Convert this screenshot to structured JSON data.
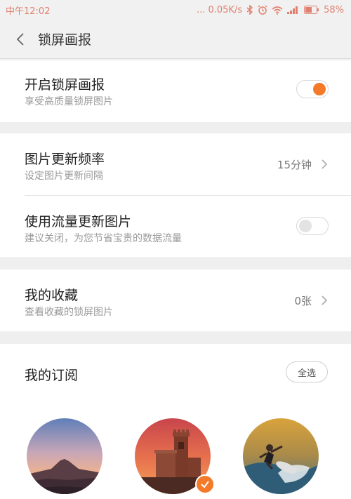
{
  "status_bar": {
    "time": "中午12:02",
    "network_speed": "... 0.05K/s",
    "battery": "58%",
    "icons": [
      "bluetooth-icon",
      "alarm-icon",
      "wifi-icon",
      "signal-icon",
      "battery-icon"
    ],
    "color": "#e08070"
  },
  "header": {
    "title": "锁屏画报"
  },
  "settings": {
    "enable": {
      "title": "开启锁屏画报",
      "subtitle": "享受高质量锁屏图片",
      "on": true
    },
    "frequency": {
      "title": "图片更新频率",
      "subtitle": "设定图片更新间隔",
      "value": "15分钟"
    },
    "use_data": {
      "title": "使用流量更新图片",
      "subtitle": "建议关闭，为您节省宝贵的数据流量",
      "on": false
    },
    "favorites": {
      "title": "我的收藏",
      "subtitle": "查看收藏的锁屏图片",
      "value": "0张"
    }
  },
  "subscriptions": {
    "title": "我的订阅",
    "select_all": "全选",
    "items": [
      {
        "name": "mountain-sunset",
        "selected": false
      },
      {
        "name": "castle-tower",
        "selected": true
      },
      {
        "name": "surfer-wave",
        "selected": false
      }
    ]
  },
  "colors": {
    "accent": "#f47a2a",
    "background": "#efefef",
    "card": "#ffffff",
    "subtext": "#9a9a9a"
  }
}
